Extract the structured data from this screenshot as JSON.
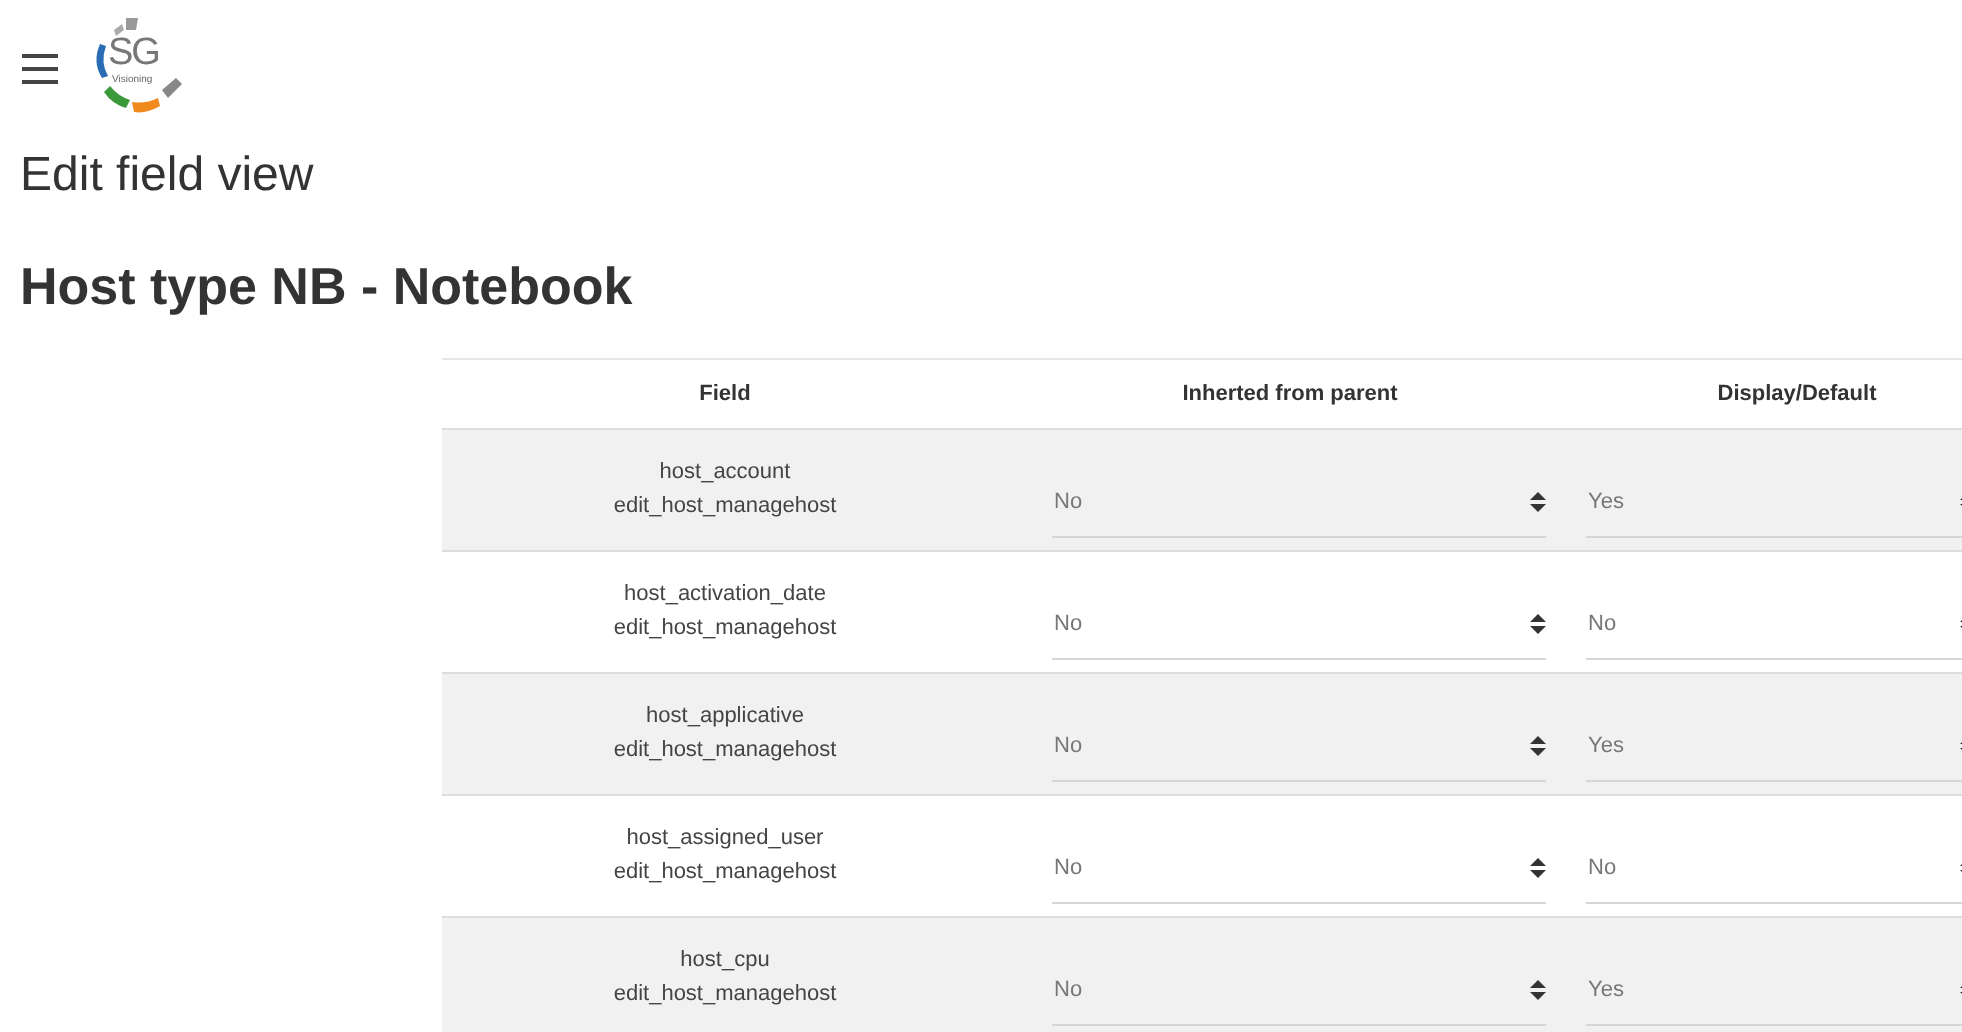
{
  "logo": {
    "initials": "SG",
    "tagline": "Visioning"
  },
  "headings": [
    "Edit field view",
    "Host type NB - Notebook"
  ],
  "table": {
    "columns": [
      "Field",
      "Inherted from parent",
      "Display/Default"
    ],
    "rows": [
      {
        "field": "host_account",
        "view": "edit_host_managehost",
        "inherited": "No",
        "display": "Yes"
      },
      {
        "field": "host_activation_date",
        "view": "edit_host_managehost",
        "inherited": "No",
        "display": "No"
      },
      {
        "field": "host_applicative",
        "view": "edit_host_managehost",
        "inherited": "No",
        "display": "Yes"
      },
      {
        "field": "host_assigned_user",
        "view": "edit_host_managehost",
        "inherited": "No",
        "display": "No"
      },
      {
        "field": "host_cpu",
        "view": "edit_host_managehost",
        "inherited": "No",
        "display": "Yes"
      }
    ]
  }
}
